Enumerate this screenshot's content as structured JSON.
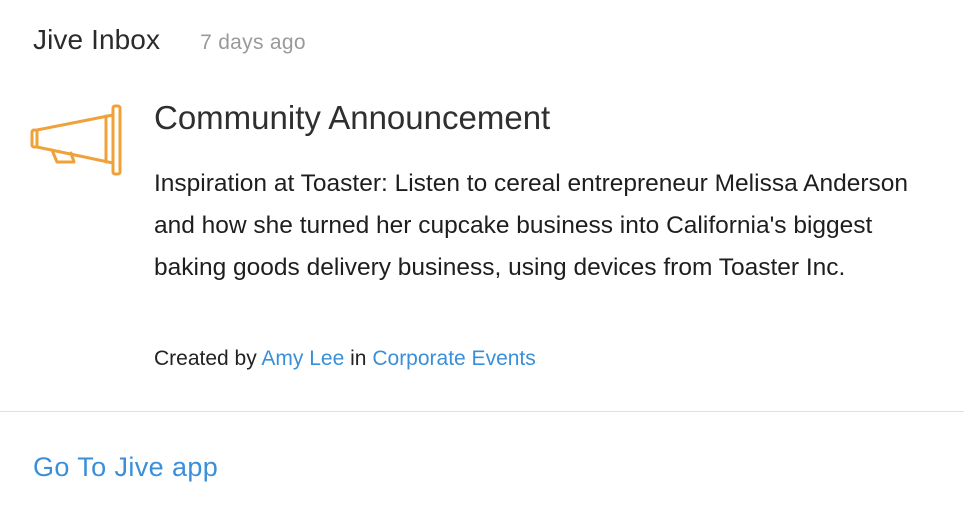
{
  "header": {
    "title": "Jive Inbox",
    "timestamp": "7 days ago"
  },
  "card": {
    "icon": "megaphone-icon",
    "icon_color": "#F0A13A",
    "title": "Community Announcement",
    "body": "Inspiration at Toaster: Listen to cereal entrepreneur Melissa Anderson and how she turned her cupcake business into California's biggest baking goods delivery business, using devices from Toaster Inc.",
    "meta": {
      "created_by_label": "Created by",
      "author": "Amy Lee",
      "in_label": "in",
      "place": "Corporate Events"
    }
  },
  "footer": {
    "link_label": "Go To Jive app"
  },
  "colors": {
    "link": "#3A8FD9",
    "muted": "#9A9A9A",
    "divider": "#E1E1E1"
  }
}
